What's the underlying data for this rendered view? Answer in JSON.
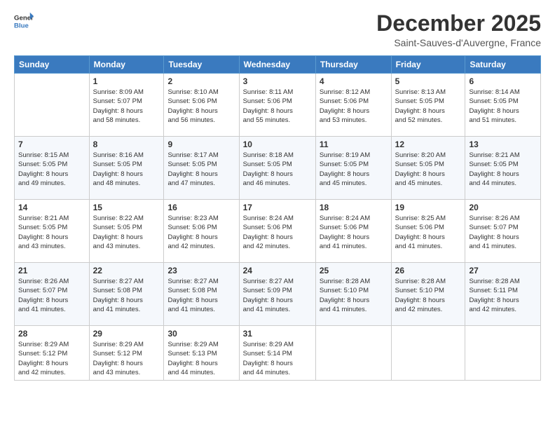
{
  "header": {
    "logo_line1": "General",
    "logo_line2": "Blue",
    "month": "December 2025",
    "location": "Saint-Sauves-d'Auvergne, France"
  },
  "weekdays": [
    "Sunday",
    "Monday",
    "Tuesday",
    "Wednesday",
    "Thursday",
    "Friday",
    "Saturday"
  ],
  "weeks": [
    [
      {
        "day": "",
        "info": ""
      },
      {
        "day": "1",
        "info": "Sunrise: 8:09 AM\nSunset: 5:07 PM\nDaylight: 8 hours\nand 58 minutes."
      },
      {
        "day": "2",
        "info": "Sunrise: 8:10 AM\nSunset: 5:06 PM\nDaylight: 8 hours\nand 56 minutes."
      },
      {
        "day": "3",
        "info": "Sunrise: 8:11 AM\nSunset: 5:06 PM\nDaylight: 8 hours\nand 55 minutes."
      },
      {
        "day": "4",
        "info": "Sunrise: 8:12 AM\nSunset: 5:06 PM\nDaylight: 8 hours\nand 53 minutes."
      },
      {
        "day": "5",
        "info": "Sunrise: 8:13 AM\nSunset: 5:05 PM\nDaylight: 8 hours\nand 52 minutes."
      },
      {
        "day": "6",
        "info": "Sunrise: 8:14 AM\nSunset: 5:05 PM\nDaylight: 8 hours\nand 51 minutes."
      }
    ],
    [
      {
        "day": "7",
        "info": "Sunrise: 8:15 AM\nSunset: 5:05 PM\nDaylight: 8 hours\nand 49 minutes."
      },
      {
        "day": "8",
        "info": "Sunrise: 8:16 AM\nSunset: 5:05 PM\nDaylight: 8 hours\nand 48 minutes."
      },
      {
        "day": "9",
        "info": "Sunrise: 8:17 AM\nSunset: 5:05 PM\nDaylight: 8 hours\nand 47 minutes."
      },
      {
        "day": "10",
        "info": "Sunrise: 8:18 AM\nSunset: 5:05 PM\nDaylight: 8 hours\nand 46 minutes."
      },
      {
        "day": "11",
        "info": "Sunrise: 8:19 AM\nSunset: 5:05 PM\nDaylight: 8 hours\nand 45 minutes."
      },
      {
        "day": "12",
        "info": "Sunrise: 8:20 AM\nSunset: 5:05 PM\nDaylight: 8 hours\nand 45 minutes."
      },
      {
        "day": "13",
        "info": "Sunrise: 8:21 AM\nSunset: 5:05 PM\nDaylight: 8 hours\nand 44 minutes."
      }
    ],
    [
      {
        "day": "14",
        "info": "Sunrise: 8:21 AM\nSunset: 5:05 PM\nDaylight: 8 hours\nand 43 minutes."
      },
      {
        "day": "15",
        "info": "Sunrise: 8:22 AM\nSunset: 5:05 PM\nDaylight: 8 hours\nand 43 minutes."
      },
      {
        "day": "16",
        "info": "Sunrise: 8:23 AM\nSunset: 5:06 PM\nDaylight: 8 hours\nand 42 minutes."
      },
      {
        "day": "17",
        "info": "Sunrise: 8:24 AM\nSunset: 5:06 PM\nDaylight: 8 hours\nand 42 minutes."
      },
      {
        "day": "18",
        "info": "Sunrise: 8:24 AM\nSunset: 5:06 PM\nDaylight: 8 hours\nand 41 minutes."
      },
      {
        "day": "19",
        "info": "Sunrise: 8:25 AM\nSunset: 5:06 PM\nDaylight: 8 hours\nand 41 minutes."
      },
      {
        "day": "20",
        "info": "Sunrise: 8:26 AM\nSunset: 5:07 PM\nDaylight: 8 hours\nand 41 minutes."
      }
    ],
    [
      {
        "day": "21",
        "info": "Sunrise: 8:26 AM\nSunset: 5:07 PM\nDaylight: 8 hours\nand 41 minutes."
      },
      {
        "day": "22",
        "info": "Sunrise: 8:27 AM\nSunset: 5:08 PM\nDaylight: 8 hours\nand 41 minutes."
      },
      {
        "day": "23",
        "info": "Sunrise: 8:27 AM\nSunset: 5:08 PM\nDaylight: 8 hours\nand 41 minutes."
      },
      {
        "day": "24",
        "info": "Sunrise: 8:27 AM\nSunset: 5:09 PM\nDaylight: 8 hours\nand 41 minutes."
      },
      {
        "day": "25",
        "info": "Sunrise: 8:28 AM\nSunset: 5:10 PM\nDaylight: 8 hours\nand 41 minutes."
      },
      {
        "day": "26",
        "info": "Sunrise: 8:28 AM\nSunset: 5:10 PM\nDaylight: 8 hours\nand 42 minutes."
      },
      {
        "day": "27",
        "info": "Sunrise: 8:28 AM\nSunset: 5:11 PM\nDaylight: 8 hours\nand 42 minutes."
      }
    ],
    [
      {
        "day": "28",
        "info": "Sunrise: 8:29 AM\nSunset: 5:12 PM\nDaylight: 8 hours\nand 42 minutes."
      },
      {
        "day": "29",
        "info": "Sunrise: 8:29 AM\nSunset: 5:12 PM\nDaylight: 8 hours\nand 43 minutes."
      },
      {
        "day": "30",
        "info": "Sunrise: 8:29 AM\nSunset: 5:13 PM\nDaylight: 8 hours\nand 44 minutes."
      },
      {
        "day": "31",
        "info": "Sunrise: 8:29 AM\nSunset: 5:14 PM\nDaylight: 8 hours\nand 44 minutes."
      },
      {
        "day": "",
        "info": ""
      },
      {
        "day": "",
        "info": ""
      },
      {
        "day": "",
        "info": ""
      }
    ]
  ]
}
